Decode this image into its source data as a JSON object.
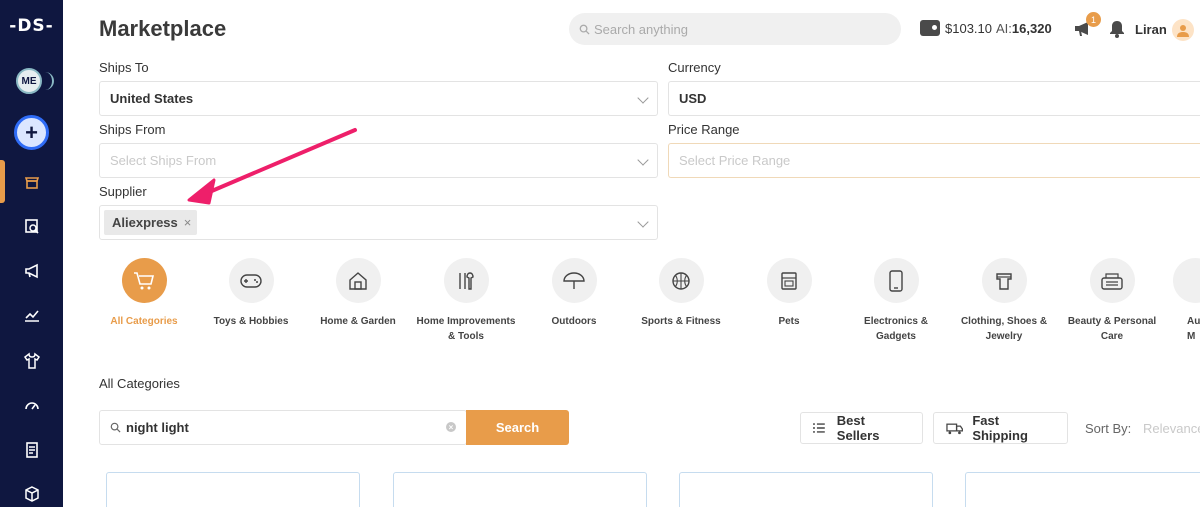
{
  "sidebar": {
    "logo": "-DS-",
    "avatar_initials": "ME",
    "add_label": "+",
    "nav": [
      "store-icon",
      "search-catalog-icon",
      "megaphone-icon",
      "chart-icon",
      "shirt-icon",
      "gauge-icon",
      "orders-icon",
      "package-icon"
    ]
  },
  "header": {
    "title": "Marketplace",
    "search_placeholder": "Search anything",
    "balance": "$103.10",
    "ai_label": "AI:",
    "ai_credits": "16,320",
    "notification_count": "1",
    "user_name": "Liran"
  },
  "filters": {
    "ships_to": {
      "label": "Ships To",
      "value": "United States"
    },
    "currency": {
      "label": "Currency",
      "value": "USD"
    },
    "ships_from": {
      "label": "Ships From",
      "placeholder": "Select Ships From"
    },
    "price_range": {
      "label": "Price Range",
      "placeholder": "Select Price Range"
    },
    "supplier": {
      "label": "Supplier",
      "chip": "Aliexpress",
      "remove": "×"
    }
  },
  "categories": [
    {
      "label": "All Categories",
      "icon": "cart-icon",
      "active": true
    },
    {
      "label": "Toys & Hobbies",
      "icon": "gamepad-icon"
    },
    {
      "label": "Home & Garden",
      "icon": "house-icon"
    },
    {
      "label": "Home Improvements & Tools",
      "icon": "tools-icon"
    },
    {
      "label": "Outdoors",
      "icon": "umbrella-icon"
    },
    {
      "label": "Sports & Fitness",
      "icon": "basketball-icon"
    },
    {
      "label": "Pets",
      "icon": "pet-food-icon"
    },
    {
      "label": "Electronics & Gadgets",
      "icon": "phone-icon"
    },
    {
      "label": "Clothing, Shoes & Jewelry",
      "icon": "shirt-icon"
    },
    {
      "label": "Beauty & Personal Care",
      "icon": "beauty-icon"
    },
    {
      "label": "Au M",
      "icon": "auto-icon"
    }
  ],
  "results": {
    "section_title": "All Categories",
    "search_value": "night light",
    "search_button": "Search",
    "best_sellers": "Best Sellers",
    "fast_shipping": "Fast Shipping",
    "sort_label": "Sort By:",
    "sort_value": "Relevance"
  },
  "colors": {
    "accent": "#e89c4a",
    "sidebar": "#0f1740",
    "annotation_arrow": "#ee1f6a"
  }
}
